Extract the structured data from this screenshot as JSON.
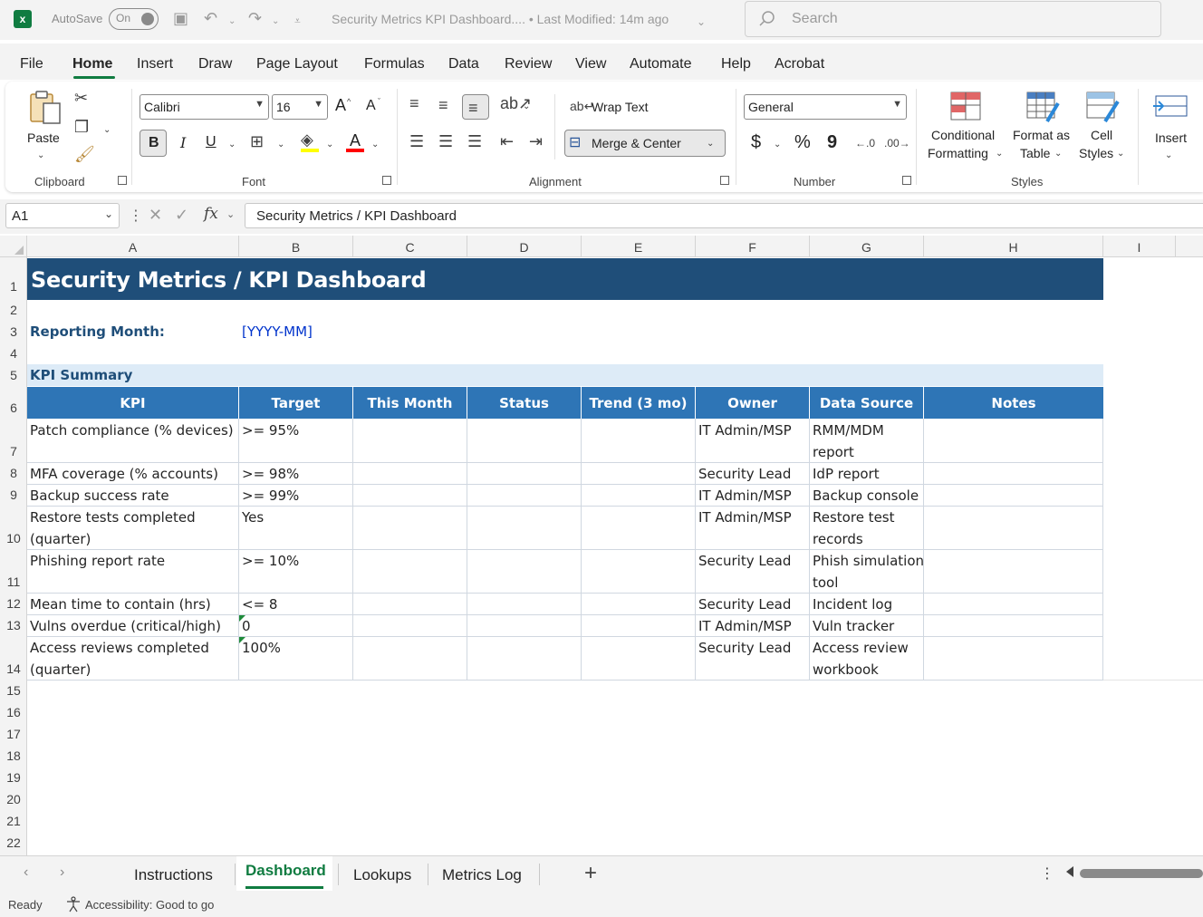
{
  "titlebar": {
    "autosave_label": "AutoSave",
    "autosave_state": "On",
    "doc_title": "Security Metrics KPI Dashboard....  •  Last Modified: 14m ago",
    "search_placeholder": "Search"
  },
  "menu_tabs": [
    "File",
    "Home",
    "Insert",
    "Draw",
    "Page Layout",
    "Formulas",
    "Data",
    "Review",
    "View",
    "Automate",
    "Help",
    "Acrobat"
  ],
  "ribbon": {
    "clipboard": {
      "paste": "Paste",
      "label": "Clipboard"
    },
    "font": {
      "name": "Calibri",
      "size": "16",
      "bold": "B",
      "italic": "I",
      "underline": "U",
      "grow": "A",
      "shrink": "A",
      "label": "Font",
      "highlight_color": "#ffff00",
      "font_color": "#ff0000"
    },
    "alignment": {
      "wrap_text": "Wrap Text",
      "merge_center": "Merge & Center",
      "label": "Alignment"
    },
    "number": {
      "format": "General",
      "currency": "$",
      "percent": "%",
      "comma": "9",
      "label": "Number"
    },
    "styles": {
      "conditional": [
        "Conditional",
        "Formatting"
      ],
      "format_table": [
        "Format as",
        "Table"
      ],
      "cell_styles": [
        "Cell",
        "Styles"
      ],
      "label": "Styles"
    },
    "cells": {
      "insert": "Insert"
    }
  },
  "formula_bar": {
    "name_box": "A1",
    "fx": "fx",
    "content": "Security Metrics / KPI Dashboard"
  },
  "columns": [
    "A",
    "B",
    "C",
    "D",
    "E",
    "F",
    "G",
    "H",
    "I"
  ],
  "rows": [
    "1",
    "2",
    "3",
    "4",
    "5",
    "6",
    "7",
    "8",
    "9",
    "10",
    "11",
    "12",
    "13",
    "14",
    "15",
    "16",
    "17",
    "18",
    "19",
    "20",
    "21",
    "22"
  ],
  "sheet": {
    "title": "Security Metrics / KPI Dashboard",
    "reporting_label": "Reporting Month:",
    "reporting_value": "[YYYY-MM]",
    "section_label": "KPI Summary",
    "headers": [
      "KPI",
      "Target",
      "This Month",
      "Status",
      "Trend (3 mo)",
      "Owner",
      "Data Source",
      "Notes"
    ],
    "table": [
      {
        "kpi": [
          "Patch compliance (% devices)"
        ],
        "target": ">= 95%",
        "owner": "IT Admin/MSP",
        "source": [
          "RMM/MDM",
          "report"
        ]
      },
      {
        "kpi": [
          "MFA coverage (% accounts)"
        ],
        "target": ">= 98%",
        "owner": "Security Lead",
        "source": [
          "IdP report"
        ]
      },
      {
        "kpi": [
          "Backup success rate"
        ],
        "target": ">= 99%",
        "owner": "IT Admin/MSP",
        "source": [
          "Backup console"
        ]
      },
      {
        "kpi": [
          "Restore tests completed",
          "(quarter)"
        ],
        "target": "Yes",
        "owner": "IT Admin/MSP",
        "source": [
          "Restore test",
          "records"
        ]
      },
      {
        "kpi": [
          "Phishing report rate"
        ],
        "target": ">= 10%",
        "owner": "Security Lead",
        "source": [
          "Phish simulation",
          "tool"
        ]
      },
      {
        "kpi": [
          "Mean time to contain (hrs)"
        ],
        "target": "<= 8",
        "owner": "Security Lead",
        "source": [
          "Incident log"
        ]
      },
      {
        "kpi": [
          "Vulns overdue (critical/high)"
        ],
        "target": "0",
        "owner": "IT Admin/MSP",
        "source": [
          "Vuln tracker"
        ]
      },
      {
        "kpi": [
          "Access reviews completed",
          "(quarter)"
        ],
        "target": "100%",
        "owner": "Security Lead",
        "source": [
          "Access review",
          "workbook"
        ]
      }
    ]
  },
  "sheet_tabs": [
    "Instructions",
    "Dashboard",
    "Lookups",
    "Metrics Log"
  ],
  "active_sheet": "Dashboard",
  "status": {
    "ready": "Ready",
    "accessibility": "Accessibility: Good to go"
  },
  "colors": {
    "title_band": "#1f4e79",
    "header_band": "#2e75b6",
    "section_band": "#ddebf7",
    "accent": "#107c41"
  }
}
